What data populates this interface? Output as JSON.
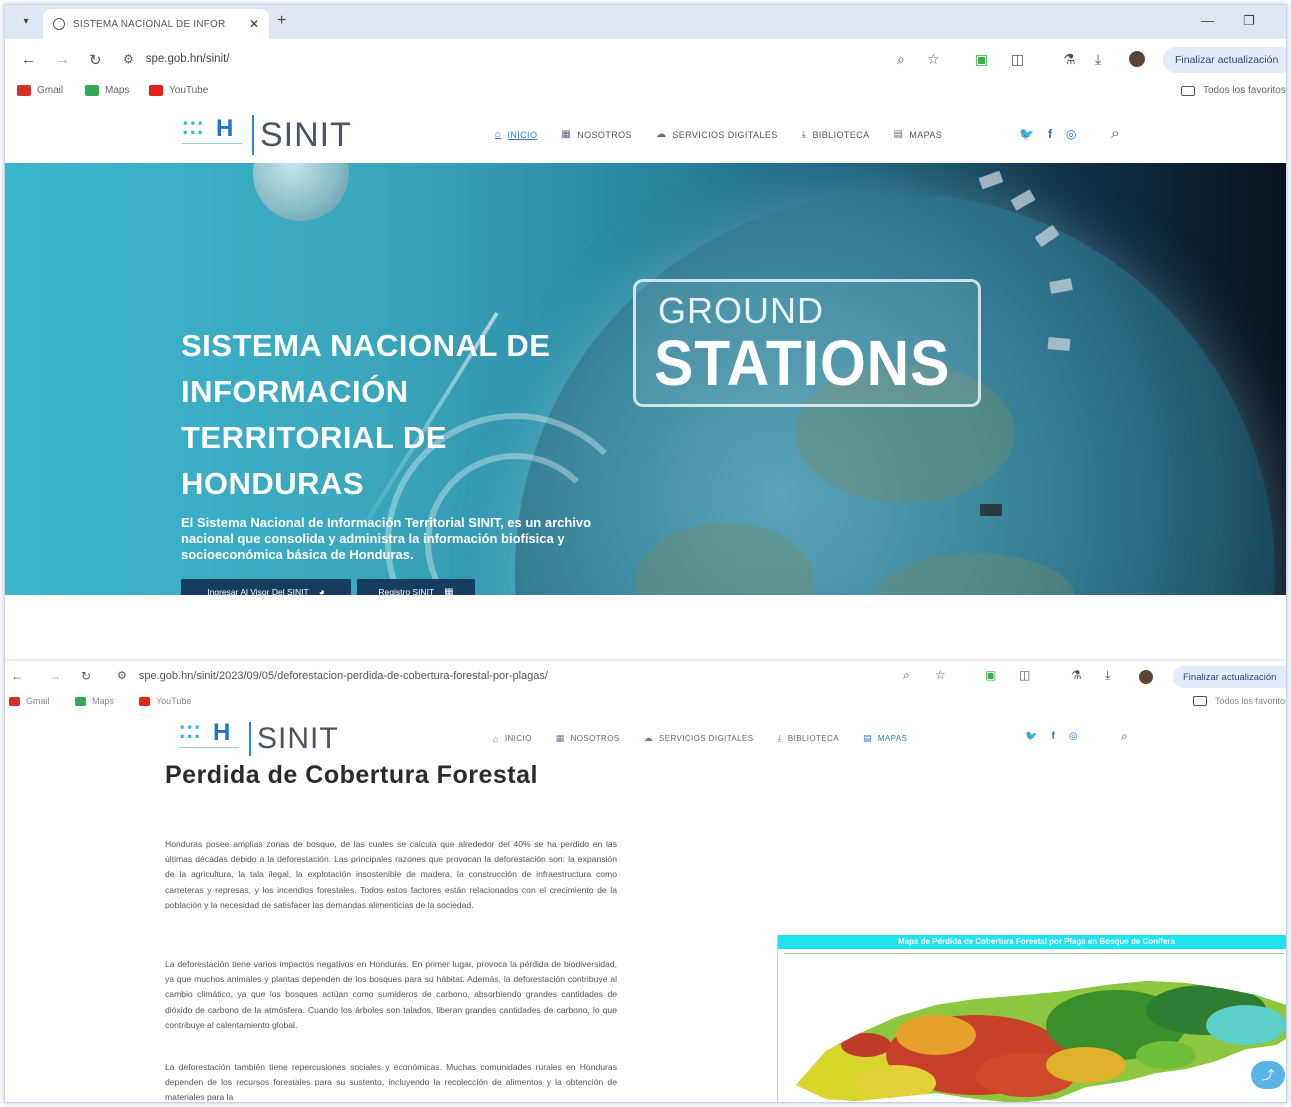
{
  "browser1": {
    "tab_title": "SISTEMA NACIONAL DE INFOR",
    "url": "spe.gob.hn/sinit/",
    "update_label": "Finalizar actualización",
    "bookmarks": [
      {
        "label": "Gmail",
        "icon": "gmail-icon",
        "color": "#d93025"
      },
      {
        "label": "Maps",
        "icon": "maps-icon",
        "color": "#34a853"
      },
      {
        "label": "YouTube",
        "icon": "youtube-icon",
        "color": "#e62117"
      }
    ],
    "favorites_label": "Todos los favoritos"
  },
  "site": {
    "logo_text": "SINIT",
    "menu": [
      {
        "label": "INICIO",
        "icon": "home-icon",
        "active": true
      },
      {
        "label": "NOSOTROS",
        "icon": "building-icon",
        "active": false
      },
      {
        "label": "SERVICIOS DIGITALES",
        "icon": "cloud-icon",
        "active": false
      },
      {
        "label": "BIBLIOTECA",
        "icon": "download-icon",
        "active": false
      },
      {
        "label": "MAPAS",
        "icon": "map-icon",
        "active": false
      }
    ],
    "social": [
      {
        "icon": "twitter-icon",
        "glyph": "🐦",
        "color": "#1d6fd6"
      },
      {
        "icon": "facebook-icon",
        "glyph": "f",
        "color": "#1d6fd6"
      },
      {
        "icon": "instagram-icon",
        "glyph": "◎",
        "color": "#1d6fd6"
      }
    ]
  },
  "hero": {
    "title_lines": [
      "SISTEMA NACIONAL DE",
      "INFORMACIÓN",
      "TERRITORIAL DE",
      "HONDURAS"
    ],
    "description": "El Sistema Nacional de Información Territorial SINIT, es un archivo nacional que consolida y administra la información biofísica y socioeconómica básica de Honduras.",
    "ground_small": "GROUND",
    "ground_big": "STATIONS",
    "button_visor": "Ingresar Al Visor Del SINIT",
    "button_registro": "Registro SINIT"
  },
  "browser2": {
    "url": "spe.gob.hn/sinit/2023/09/05/deforestacion-perdida-de-cobertura-forestal-por-plagas/",
    "update_label": "Finalizar actualización",
    "favorites_label": "Todos los favoritos"
  },
  "article": {
    "title": "Perdida de Cobertura Forestal",
    "paragraphs": [
      "Honduras posee amplias zonas de bosque, de las cuales se calcula que alrededor del 40% se ha perdido en las últimas décadas debido a la deforestación. Las principales razones que provocan la deforestación son: la expansión de la agricultura, la tala ilegal, la explotación insostenible de madera, la construcción de infraestructura como carreteras y represas, y los incendios forestales. Todos estos factores están relacionados con el crecimiento de la población y la necesidad de satisfacer las demandas alimenticias de la sociedad.",
      "La deforestación tiene varios impactos negativos en Honduras. En primer lugar, provoca la pérdida de biodiversidad, ya que muchos animales y plantas dependen de los bosques para su hábitat. Además, la deforestación contribuye al cambio climático, ya que los bosques actúan como sumideros de carbono, absorbiendo grandes cantidades de dióxido de carbono de la atmósfera. Cuando los árboles son talados, liberan grandes cantidades de carbono, lo que contribuye al calentamiento global.",
      "La deforestación también tiene repercusiones sociales y económicas. Muchas comunidades rurales en Honduras dependen de los recursos forestales para su sustento, incluyendo la recolección de alimentos y la obtención de materiales para la"
    ],
    "map_title": "Mapa de Pérdida de Cobertura Forestal por Plaga en Bosque de Conífera"
  }
}
